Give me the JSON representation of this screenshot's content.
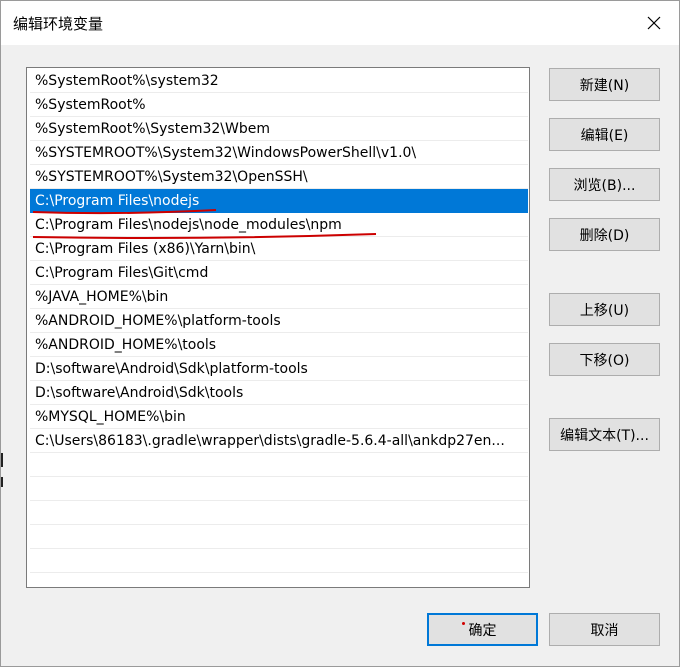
{
  "window": {
    "title": "编辑环境变量",
    "close_icon": "close-icon"
  },
  "path_list": {
    "entries": [
      "%SystemRoot%\\system32",
      "%SystemRoot%",
      "%SystemRoot%\\System32\\Wbem",
      "%SYSTEMROOT%\\System32\\WindowsPowerShell\\v1.0\\",
      "%SYSTEMROOT%\\System32\\OpenSSH\\",
      "C:\\Program Files\\nodejs",
      "C:\\Program Files\\nodejs\\node_modules\\npm",
      "C:\\Program Files (x86)\\Yarn\\bin\\",
      "C:\\Program Files\\Git\\cmd",
      "%JAVA_HOME%\\bin",
      "%ANDROID_HOME%\\platform-tools",
      "%ANDROID_HOME%\\tools",
      "D:\\software\\Android\\Sdk\\platform-tools",
      "D:\\software\\Android\\Sdk\\tools",
      "%MYSQL_HOME%\\bin",
      "C:\\Users\\86183\\.gradle\\wrapper\\dists\\gradle-5.6.4-all\\ankdp27en..."
    ],
    "selected_index": 5
  },
  "buttons": {
    "new": "新建(N)",
    "edit": "编辑(E)",
    "browse": "浏览(B)...",
    "delete": "删除(D)",
    "move_up": "上移(U)",
    "move_down": "下移(O)",
    "edit_text": "编辑文本(T)...",
    "ok": "确定",
    "cancel": "取消"
  },
  "colors": {
    "selection": "#0078d7",
    "annotation_underline": "#cc0000"
  }
}
